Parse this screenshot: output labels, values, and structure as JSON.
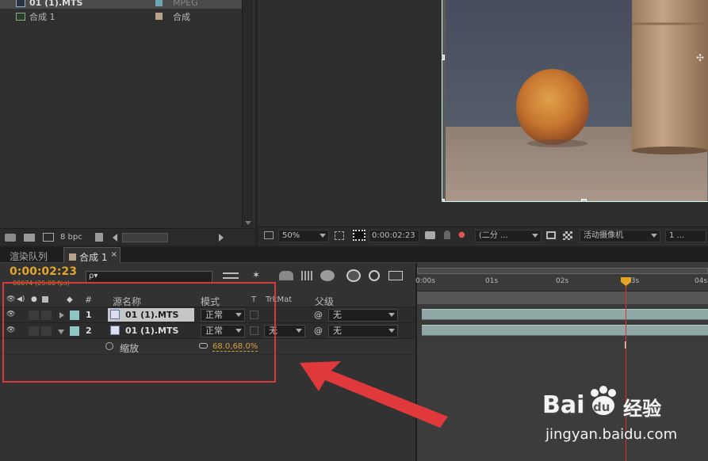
{
  "project": {
    "items": [
      {
        "name": "01 (1).MTS",
        "type": "MPEG",
        "swatch": "#6aa7b5"
      },
      {
        "name": "合成 1",
        "type": "合成",
        "swatch": "#b9a389"
      }
    ],
    "bpc": "8 bpc"
  },
  "viewer": {
    "zoom": "50%",
    "timecode": "0:00:02:23",
    "resolution": "(二分 ...",
    "camera": "活动摄像机",
    "views": "1 ..."
  },
  "tabs": [
    {
      "label": "渲染队列",
      "active": false
    },
    {
      "label": "合成 1",
      "active": true,
      "close": "×"
    }
  ],
  "timeline": {
    "timecode": "0:00:02:23",
    "frames": "00074 (25.00 fps)",
    "search_placeholder": "ρ▾",
    "headers": {
      "num": "#",
      "source": "源名称",
      "mode": "模式",
      "t": "T",
      "trkmat": "TrkMat",
      "parent": "父级"
    },
    "layers": [
      {
        "num": "1",
        "name": "01 (1).MTS",
        "mode": "正常",
        "trkmat": "",
        "parent": "无",
        "color": "#8ec6c2",
        "expanded": false
      },
      {
        "num": "2",
        "name": "01 (1).MTS",
        "mode": "正常",
        "trkmat": "无",
        "parent": "无",
        "color": "#8ec6c2",
        "expanded": true
      }
    ],
    "property": {
      "name": "缩放",
      "value": "68.0,68.0%"
    },
    "ruler": [
      "0:00s",
      "01s",
      "02s",
      "03s",
      "04s"
    ],
    "playhead_time": "02:23"
  },
  "annotation": {
    "box_color": "#d43a3a",
    "arrow_color": "#e0393b"
  },
  "watermark": {
    "brand": "Bai",
    "brand2": "du",
    "cn": "经验",
    "url": "jingyan.baidu.com"
  }
}
